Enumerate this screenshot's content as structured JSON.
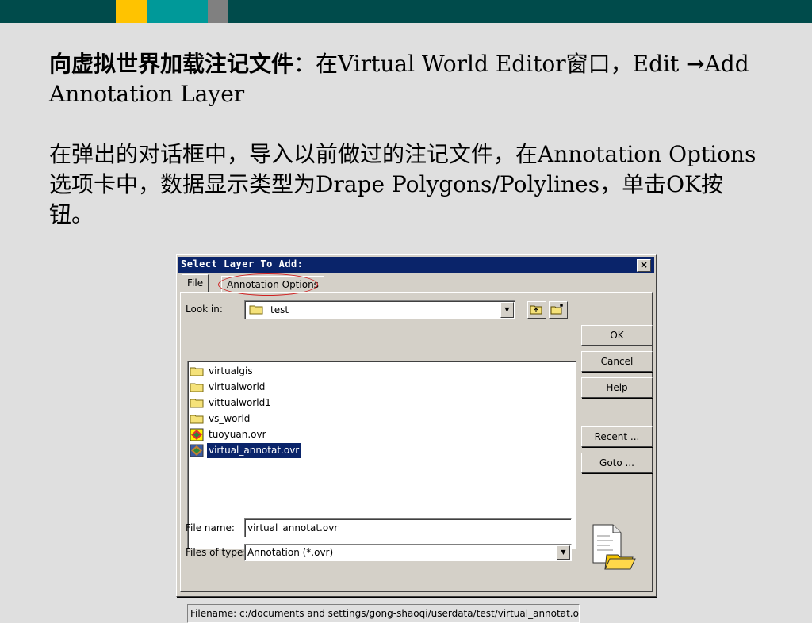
{
  "colors": {
    "topbar": "#004b4b",
    "yellow": "#ffc300",
    "teal": "#009999",
    "gray": "#808080",
    "highlight": "#0a246a",
    "annotation_circle": "#d02020"
  },
  "slide": {
    "line1_bold": "向虚拟世界加载注记文件",
    "line1_rest": "：在Virtual World Editor窗口，Edit ",
    "line1_arrow": "→",
    "line1_end": "Add Annotation Layer",
    "para2": "在弹出的对话框中，导入以前做过的注记文件，在Annotation Options选项卡中，数据显示类型为Drape Polygons/Polylines，单击OK按钮。"
  },
  "dialog": {
    "title": "Select Layer To Add:",
    "close_label": "×",
    "tabs": [
      {
        "label": "File"
      },
      {
        "label": "Annotation Options"
      }
    ],
    "look_in_label": "Look in:",
    "look_in_value": "test",
    "files": [
      {
        "name": "virtualgis",
        "icon": "folder-icon"
      },
      {
        "name": "virtualworld",
        "icon": "folder-icon"
      },
      {
        "name": "vittualworld1",
        "icon": "folder-icon"
      },
      {
        "name": "vs_world",
        "icon": "folder-icon"
      },
      {
        "name": "tuoyuan.ovr",
        "icon": "ovr-file-icon"
      },
      {
        "name": "virtual_annotat.ovr",
        "icon": "ovr-file-icon",
        "selected": true
      }
    ],
    "buttons": {
      "ok": "OK",
      "cancel": "Cancel",
      "help": "Help",
      "recent": "Recent ...",
      "goto": "Goto ..."
    },
    "file_name_label": "File name:",
    "file_name_value": "virtual_annotat.ovr",
    "file_type_label": "Files of type:",
    "file_type_value": "Annotation (*.ovr)",
    "status": "Filename: c:/documents and settings/gong-shaoqi/userdata/test/virtual_annotat.ovr -"
  }
}
